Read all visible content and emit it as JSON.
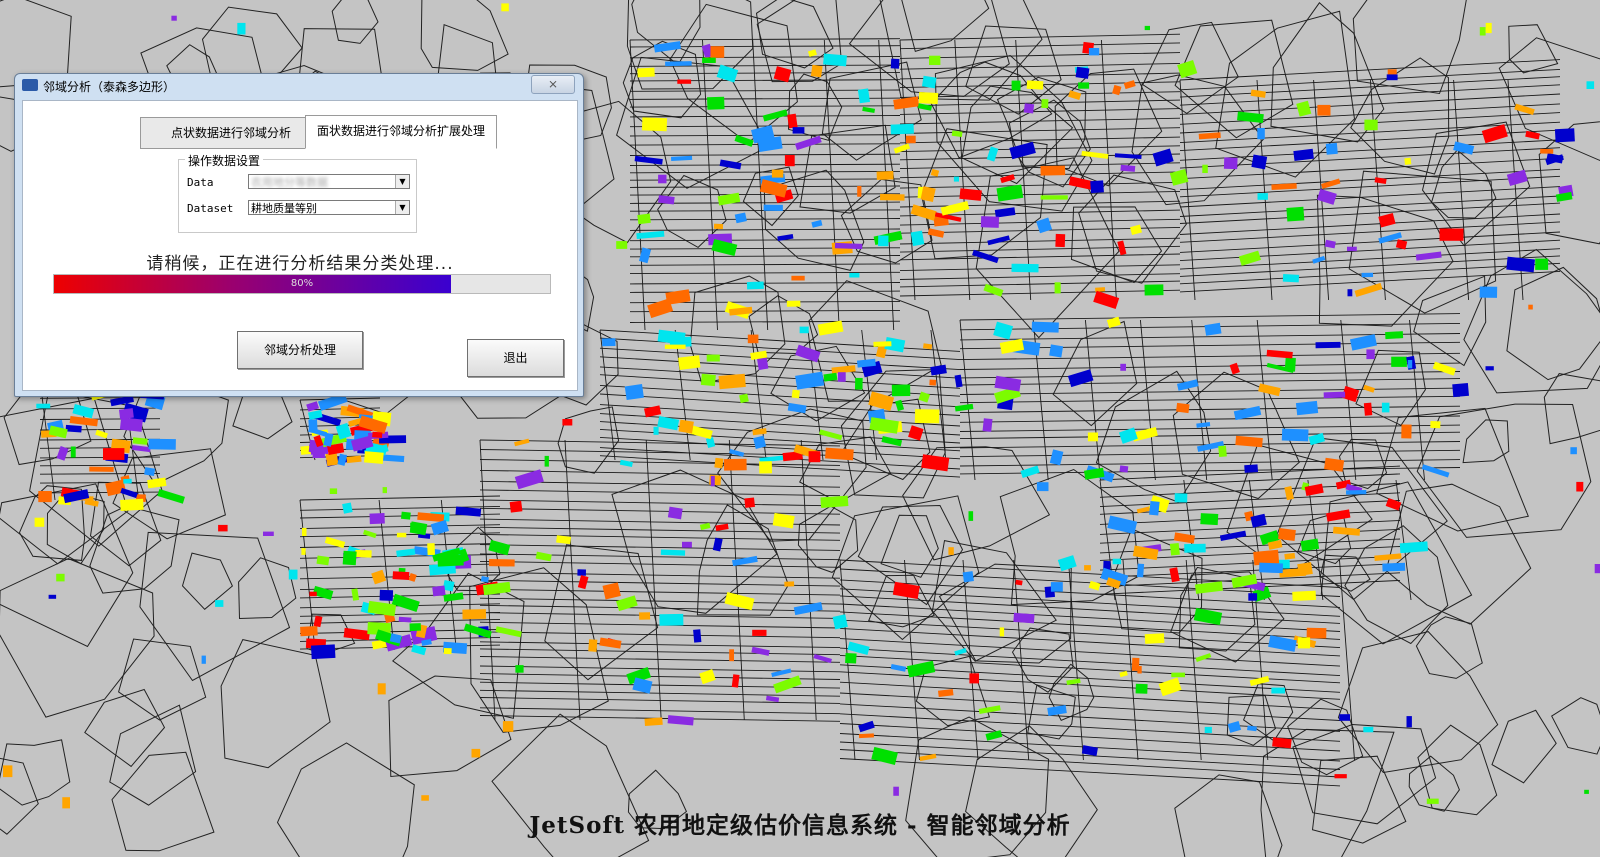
{
  "footer": {
    "title": "JetSoft 农用地定级估价信息系统 - 智能邻域分析"
  },
  "dialog": {
    "title": "邻域分析（泰森多边形）",
    "close_label": "⨯",
    "tabs": [
      {
        "label": "点状数据进行邻域分析"
      },
      {
        "label": "面状数据进行邻域分析扩展处理"
      }
    ],
    "group_label": "操作数据设置",
    "data_label": "Data",
    "data_value": "农用地分等数据",
    "dataset_label": "Dataset",
    "dataset_value": "耕地质量等别",
    "status": "请稍候，正在进行分析结果分类处理...",
    "progress_percent": 80,
    "progress_text": "80%",
    "analyze_label": "邻域分析处理",
    "exit_label": "退出"
  },
  "colors": {
    "map_background": "#c4c4c4",
    "patch_palette": [
      "#ff0000",
      "#ff6a00",
      "#ffa500",
      "#ffff00",
      "#7cfc00",
      "#00e000",
      "#00e5ee",
      "#1e90ff",
      "#0000cd",
      "#8a2be2"
    ]
  }
}
